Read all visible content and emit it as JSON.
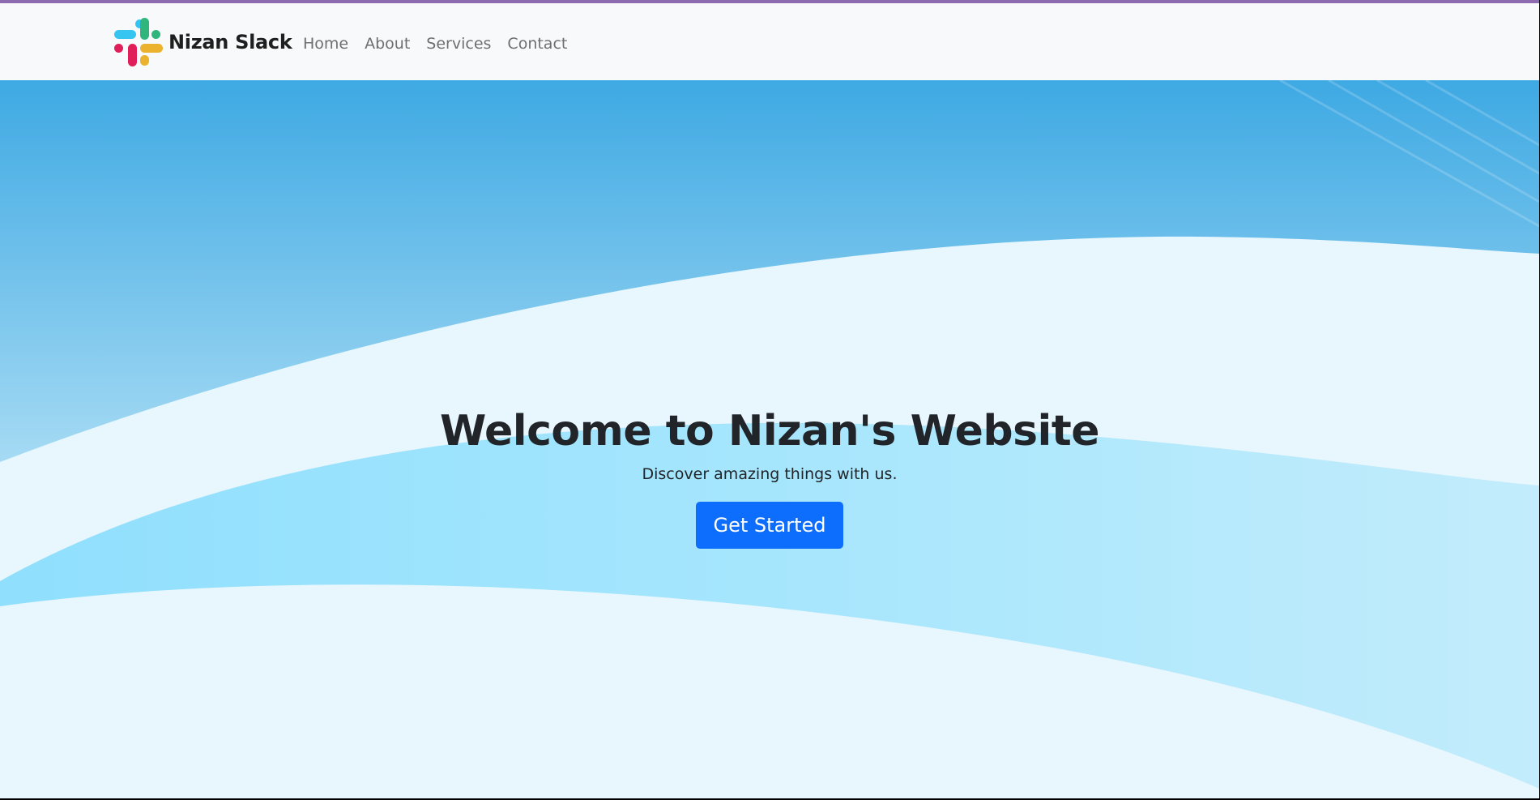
{
  "navbar": {
    "brand_name": "Nizan Slack",
    "logo_icon": "slack-logo-icon",
    "links": [
      {
        "label": "Home"
      },
      {
        "label": "About"
      },
      {
        "label": "Services"
      },
      {
        "label": "Contact"
      }
    ]
  },
  "hero": {
    "title": "Welcome to Nizan's Website",
    "subtitle": "Discover amazing things with us.",
    "cta_label": "Get Started"
  },
  "colors": {
    "accent_bar": "#8e6bb0",
    "navbar_bg": "#f8f9fa",
    "button_bg": "#0d6efd",
    "sky_top": "#3ea9e3",
    "wave_light": "#e8f6fd",
    "wave_mid": "#9fe2fd"
  }
}
